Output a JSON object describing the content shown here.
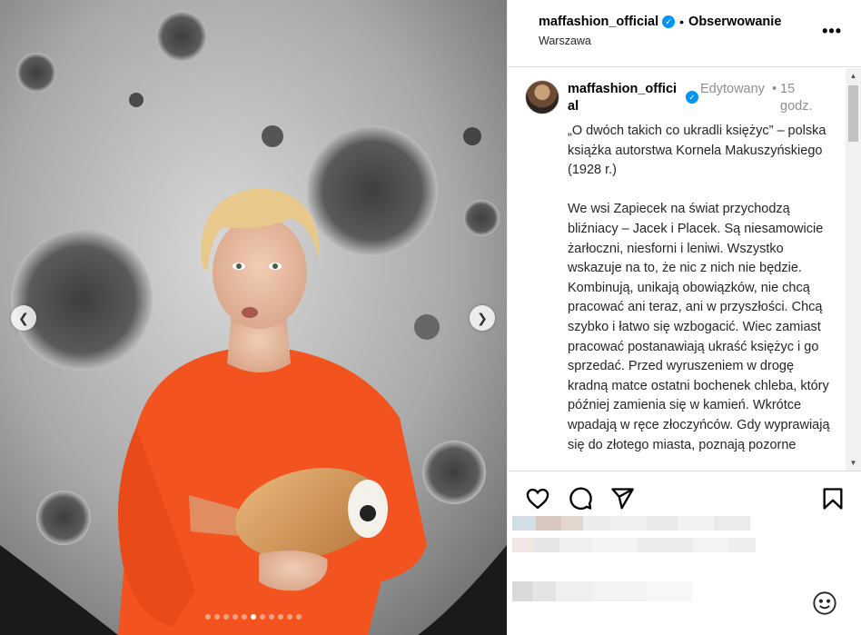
{
  "header": {
    "username": "maffashion_official",
    "separator": "•",
    "follow_label": "Obserwowanie",
    "location": "Warszawa",
    "more_label": "•••"
  },
  "caption": {
    "username": "maffashion_official",
    "edited_label": "Edytowany",
    "dot": "•",
    "time": "15 godz.",
    "text": "„O dwóch takich co ukradli księżyc” – polska książka autorstwa Kornela Makuszyńskiego (1928 r.)\n\nWe wsi Zapiecek na świat przychodzą bliźniacy – Jacek i Placek. Są niesamowicie żarłoczni, niesforni i leniwi. Wszystko wskazuje na to, że nic z nich nie będzie. Kombinują, unikają obowiązków, nie chcą pracować ani teraz, ani w przyszłości. Chcą szybko i łatwo się wzbogacić. Wiec zamiast pracować postanawiają ukraść księżyc i go sprzedać. Przed wyruszeniem w drogę kradną matce ostatni bochenek chleba, który później zamienia się w kamień. Wkrótce wpadają w ręce złoczyńców. Gdy wyprawiają się do złotego miasta, poznają pozorne"
  },
  "carousel": {
    "dot_count": 11,
    "active_index": 5
  },
  "icons": {
    "like": "heart-icon",
    "comment": "comment-icon",
    "share": "paper-plane-icon",
    "save": "bookmark-icon",
    "emoji": "smiley-icon",
    "prev": "chevron-left-icon",
    "next": "chevron-right-icon"
  },
  "colors": {
    "verified": "#0095f6",
    "muted": "#8e8e8e",
    "divider": "#dbdbdb",
    "sweater": "#f2531f"
  }
}
